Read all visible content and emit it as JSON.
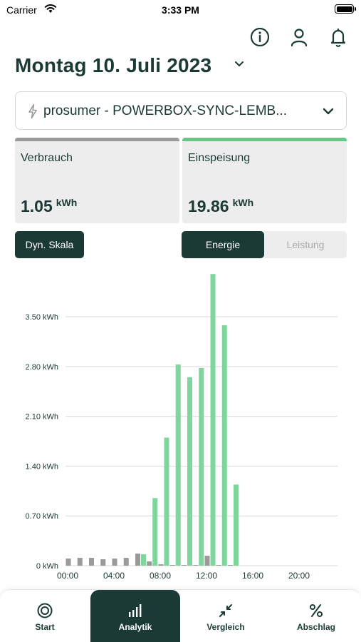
{
  "status_bar": {
    "carrier": "Carrier",
    "time": "3:33 PM"
  },
  "header": {
    "icons": [
      "info-icon",
      "user-icon",
      "bell-icon"
    ],
    "date_title": "Montag 10. Juli 2023"
  },
  "device_select": {
    "value": "prosumer - POWERBOX-SYNC-LEMB..."
  },
  "cards": [
    {
      "title": "Verbrauch",
      "value": "1.05",
      "unit": "kWh",
      "accent": "#9a9a9a"
    },
    {
      "title": "Einspeisung",
      "value": "19.86",
      "unit": "kWh",
      "accent": "#5ccb84"
    }
  ],
  "controls": {
    "scale_button": "Dyn. Skala",
    "mode_active": "Energie",
    "mode_inactive": "Leistung"
  },
  "colors": {
    "primary": "#1b3a36",
    "consumption": "#9a9a9a",
    "feed_in": "#7ed69c"
  },
  "chart_data": {
    "type": "bar",
    "x_ticks": [
      "00:00",
      "04:00",
      "08:00",
      "12:00",
      "16:00",
      "20:00"
    ],
    "y_ticks": [
      "0 kWh",
      "0.70 kWh",
      "1.40 kWh",
      "2.10 kWh",
      "2.80 kWh",
      "3.50 kWh"
    ],
    "ylim": [
      0,
      4.2
    ],
    "xlim_hours": [
      0,
      24
    ],
    "grid": true,
    "series": [
      {
        "name": "Verbrauch",
        "color": "#9a9a9a",
        "hours": [
          0,
          1,
          2,
          3,
          4,
          5,
          6,
          7,
          8,
          9,
          10,
          11,
          12,
          13,
          14
        ],
        "values": [
          0.1,
          0.11,
          0.11,
          0.09,
          0.1,
          0.11,
          0.17,
          0.06,
          0.02,
          0.01,
          0.01,
          0.01,
          0.14,
          0.01,
          0.01
        ]
      },
      {
        "name": "Einspeisung",
        "color": "#7ed69c",
        "hours": [
          6,
          7,
          8,
          9,
          10,
          11,
          12,
          13,
          14
        ],
        "values": [
          0.16,
          0.95,
          1.8,
          2.83,
          2.65,
          2.78,
          4.1,
          3.38,
          1.14
        ]
      }
    ]
  },
  "tabs": [
    {
      "label": "Start",
      "icon": "target-icon",
      "active": false
    },
    {
      "label": "Analytik",
      "icon": "bar-chart-icon",
      "active": true
    },
    {
      "label": "Vergleich",
      "icon": "compare-arrows-icon",
      "active": false
    },
    {
      "label": "Abschlag",
      "icon": "percent-icon",
      "active": false
    }
  ]
}
